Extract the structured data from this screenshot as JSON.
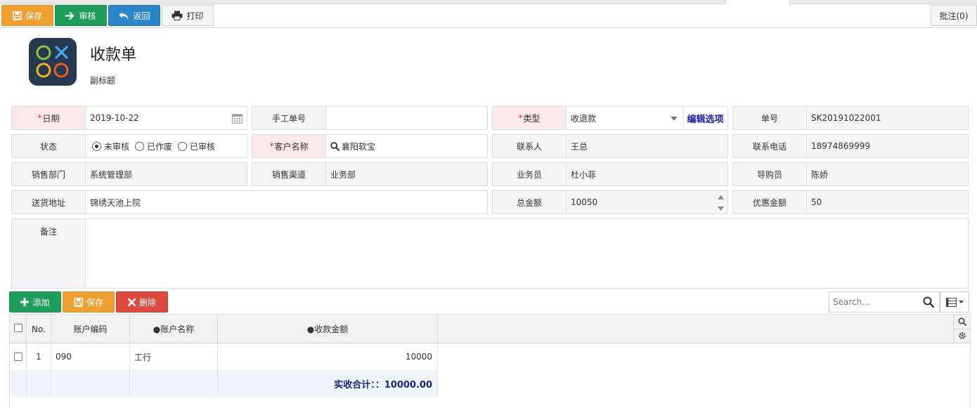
{
  "toolbar": {
    "save": "保存",
    "audit": "审核",
    "back": "返回",
    "print": "打印",
    "note": "批注(0)"
  },
  "header": {
    "title": "收款单",
    "subtitle": "副标题"
  },
  "form": {
    "date": {
      "label": "日期",
      "value": "2019-10-22"
    },
    "manual_no": {
      "label": "手工单号",
      "value": ""
    },
    "type": {
      "label": "类型",
      "value": "收退款",
      "edit_options": "编辑选项"
    },
    "doc_no": {
      "label": "单号",
      "value": "SK20191022001"
    },
    "status": {
      "label": "状态",
      "options": [
        "未审核",
        "已作废",
        "已审核"
      ],
      "selected": "未审核"
    },
    "customer": {
      "label": "客户名称",
      "value": "襄阳软宝"
    },
    "contact": {
      "label": "联系人",
      "value": "王总"
    },
    "phone": {
      "label": "联系电话",
      "value": "18974869999"
    },
    "dept": {
      "label": "销售部门",
      "value": "系统管理部"
    },
    "channel": {
      "label": "销售渠道",
      "value": "业务部"
    },
    "salesman": {
      "label": "业务员",
      "value": "杜小菲"
    },
    "guide": {
      "label": "导购员",
      "value": "陈娇"
    },
    "address": {
      "label": "送货地址",
      "value": "锦绣天池上院"
    },
    "total": {
      "label": "总金额",
      "value": "10050"
    },
    "discount": {
      "label": "优惠金额",
      "value": "50"
    },
    "remark": {
      "label": "备注",
      "value": ""
    }
  },
  "grid_toolbar": {
    "add": "添加",
    "save": "保存",
    "delete": "删除",
    "search_placeholder": "Search..."
  },
  "table": {
    "columns": [
      "No.",
      "账户编码",
      "●账户名称",
      "●收款金额"
    ],
    "rows": [
      {
        "no": "1",
        "code": "090",
        "name": "工行",
        "amount": "10000"
      }
    ],
    "summary": "实收合计：：10000.00"
  },
  "colors": {
    "orange": "#f0a030",
    "green": "#1e9e5a",
    "blue": "#2a86c8",
    "red": "#dd4a3e",
    "required_bg": "#fbe8e8",
    "summary_text": "#1a237e"
  }
}
